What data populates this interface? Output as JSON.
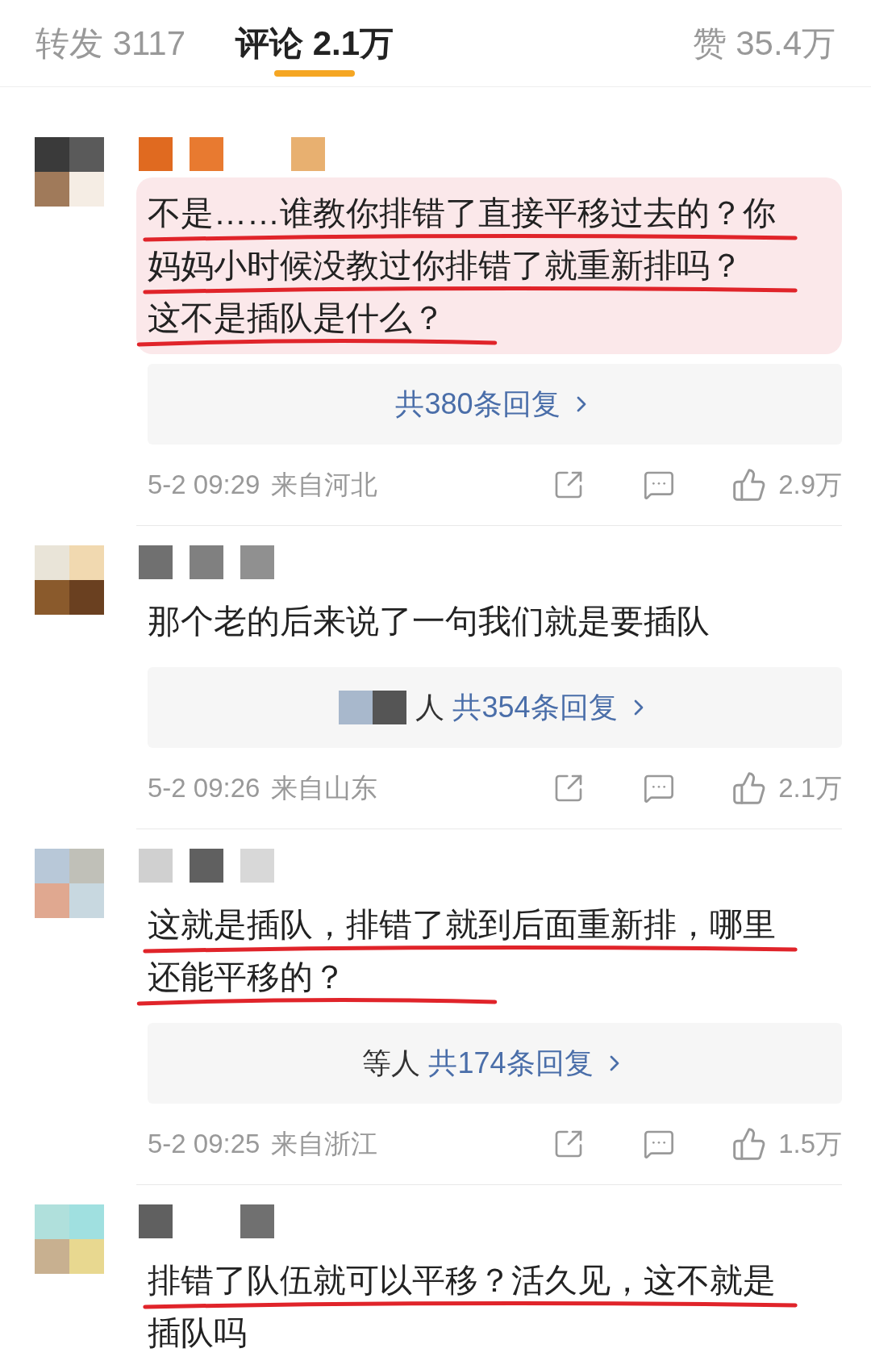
{
  "tabs": [
    {
      "label": "转发 3117",
      "selected": false
    },
    {
      "label": "评论 2.1万",
      "selected": true
    },
    {
      "label": "赞 35.4万",
      "selected": false
    }
  ],
  "comments": [
    {
      "highlighted": true,
      "lines": [
        {
          "text": "不是……谁教你排错了直接平移过去的？你",
          "underlined": true
        },
        {
          "text": "妈妈小时候没教过你排错了就重新排吗？",
          "underlined": true
        },
        {
          "text": "这不是插队是什么？",
          "underlined": true
        }
      ],
      "replies": {
        "blurred": false,
        "label": "共380条回复"
      },
      "time": "5-2 09:29",
      "location": "来自河北",
      "likes": "2.9万"
    },
    {
      "highlighted": false,
      "lines": [
        {
          "text": "那个老的后来说了一句我们就是要插队",
          "underlined": false
        }
      ],
      "replies": {
        "blurred": true,
        "prefix": "人",
        "label": "共354条回复"
      },
      "time": "5-2 09:26",
      "location": "来自山东",
      "likes": "2.1万"
    },
    {
      "highlighted": false,
      "lines": [
        {
          "text": "这就是插队，排错了就到后面重新排，哪里",
          "underlined": true
        },
        {
          "text": "还能平移的？",
          "underlined": true
        }
      ],
      "replies": {
        "blurred": false,
        "prefix": "等人",
        "label": "共174条回复"
      },
      "time": "5-2 09:25",
      "location": "来自浙江",
      "likes": "1.5万"
    },
    {
      "highlighted": false,
      "lines": [
        {
          "text": "排错了队伍就可以平移？活久见，这不就是",
          "underlined": true
        },
        {
          "text": "插队吗",
          "underlined": false
        }
      ]
    }
  ]
}
